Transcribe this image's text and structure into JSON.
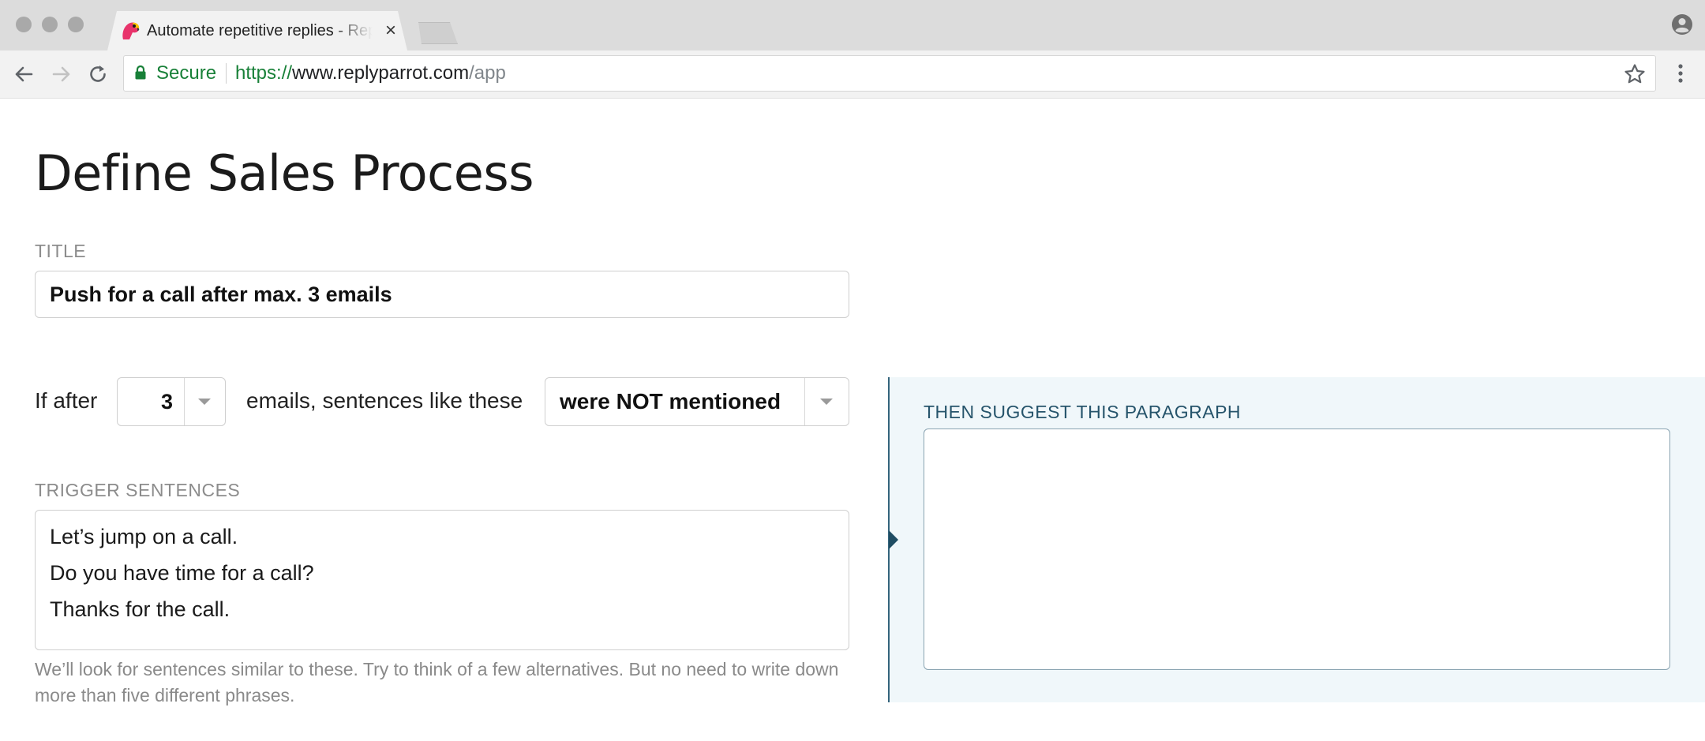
{
  "browser": {
    "tab_title": "Automate repetitive replies - ReplyParrot",
    "tab_close": "×",
    "secure_label": "Secure",
    "url_scheme": "https://",
    "url_host": "www.replyparrot.com",
    "url_path": "/app",
    "icons": {
      "favicon": "parrot-favicon-icon",
      "back": "arrow-left-icon",
      "forward": "arrow-right-icon",
      "reload": "reload-icon",
      "lock": "lock-icon",
      "star": "star-icon",
      "menu": "kebab-menu-icon",
      "profile": "profile-icon"
    },
    "colors": {
      "secure": "#188038",
      "chrome": "#dcdcdc"
    }
  },
  "page": {
    "heading": "Define Sales Process",
    "title_field": {
      "label": "TITLE",
      "value": "Push for a call after max. 3 emails"
    },
    "rule": {
      "prefix": "If after",
      "email_count": "3",
      "middle": "emails, sentences like these",
      "mention_mode": "were NOT mentioned"
    },
    "trigger": {
      "label": "TRIGGER SENTENCES",
      "sentences": [
        "Let’s jump on a call.",
        "Do you have time for a call?",
        "Thanks for the call."
      ],
      "help": "We’ll look for sentences similar to these. Try to think of a few alternatives. But no need to write down more than five different phrases."
    },
    "suggestion": {
      "label": "THEN SUGGEST THIS PARAGRAPH",
      "value": ""
    },
    "colors": {
      "panel_bg": "#f0f7fa",
      "panel_accent": "#34647c"
    }
  }
}
